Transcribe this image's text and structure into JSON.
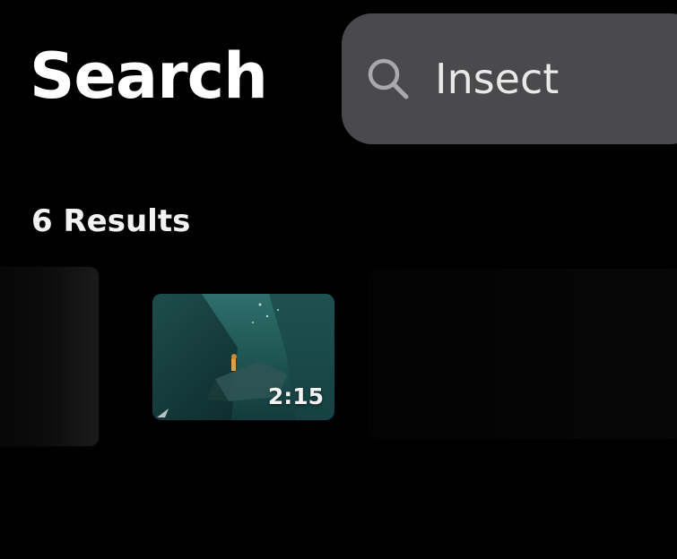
{
  "header": {
    "title": "Search"
  },
  "search": {
    "query": "Insect",
    "icon": "search-icon"
  },
  "results": {
    "count_label": "6 Results",
    "items": [
      {
        "duration": "2:15"
      }
    ]
  },
  "colors": {
    "background": "#000000",
    "search_bar": "#4a4a4d",
    "text": "#ffffff"
  }
}
